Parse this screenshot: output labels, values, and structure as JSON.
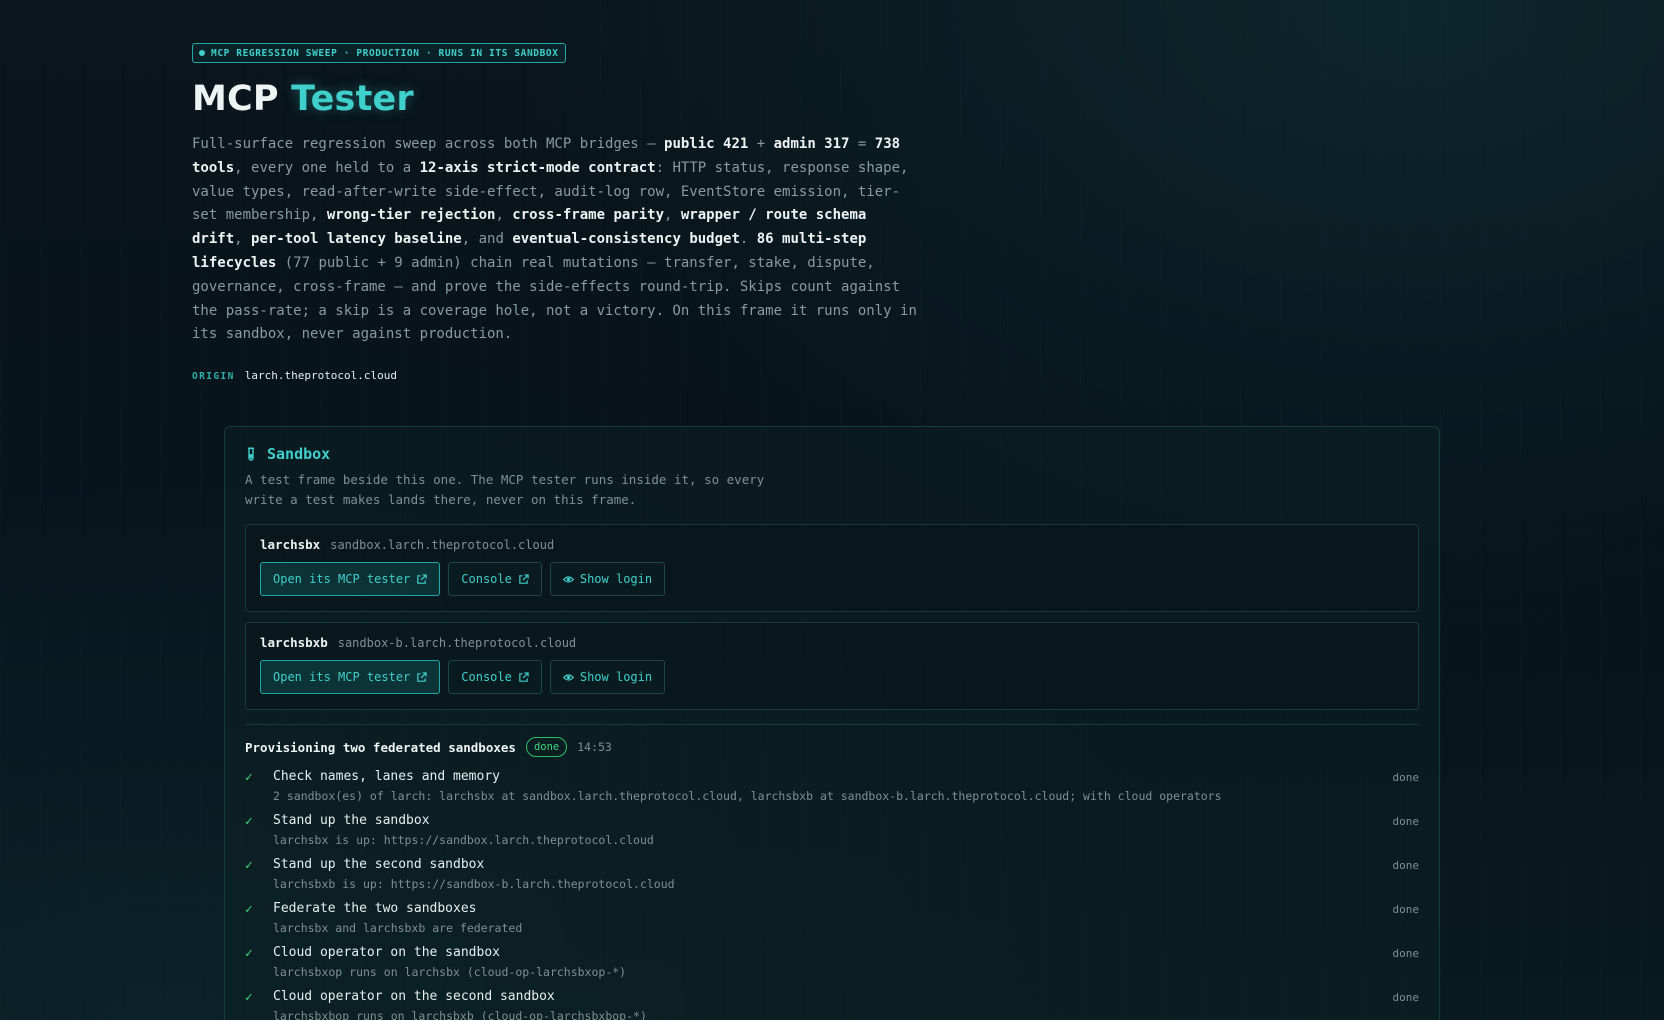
{
  "hero": {
    "pill": "MCP REGRESSION SWEEP · PRODUCTION · RUNS IN ITS SANDBOX",
    "title_a": "MCP",
    "title_b": "Tester",
    "lead": [
      {
        "t": "Full-surface regression sweep across both MCP bridges — ",
        "b": false
      },
      {
        "t": "public 421",
        "b": true
      },
      {
        "t": " + ",
        "b": false
      },
      {
        "t": "admin 317",
        "b": true
      },
      {
        "t": " = ",
        "b": false
      },
      {
        "t": "738 tools",
        "b": true
      },
      {
        "t": ", every one held to a ",
        "b": false
      },
      {
        "t": "12-axis strict-mode contract",
        "b": true
      },
      {
        "t": ": HTTP status, response shape, value types, read-after-write side-effect, audit-log row, EventStore emission, tier-set membership, ",
        "b": false
      },
      {
        "t": "wrong-tier rejection",
        "b": true
      },
      {
        "t": ", ",
        "b": false
      },
      {
        "t": "cross-frame parity",
        "b": true
      },
      {
        "t": ", ",
        "b": false
      },
      {
        "t": "wrapper / route schema drift",
        "b": true
      },
      {
        "t": ", ",
        "b": false
      },
      {
        "t": "per-tool latency baseline",
        "b": true
      },
      {
        "t": ", and ",
        "b": false
      },
      {
        "t": "eventual-consistency budget",
        "b": true
      },
      {
        "t": ". ",
        "b": false
      },
      {
        "t": "86 multi-step lifecycles",
        "b": true
      },
      {
        "t": " (77 public + 9 admin) chain real mutations — transfer, stake, dispute, governance, cross-frame — and prove the side-effects round-trip. Skips count against the pass-rate; a skip is a coverage hole, not a victory. On this frame it runs only in its sandbox, never against production.",
        "b": false
      }
    ],
    "origin_label": "ORIGIN",
    "origin_value": "larch.theprotocol.cloud"
  },
  "sandbox": {
    "title": "Sandbox",
    "description": "A test frame beside this one. The MCP tester runs inside it, so every write a test makes lands there, never on this frame.",
    "items": [
      {
        "name": "larchsbx",
        "host": "sandbox.larch.theprotocol.cloud",
        "open_label": "Open its MCP tester",
        "console_label": "Console",
        "login_label": "Show login"
      },
      {
        "name": "larchsbxb",
        "host": "sandbox-b.larch.theprotocol.cloud",
        "open_label": "Open its MCP tester",
        "console_label": "Console",
        "login_label": "Show login"
      }
    ]
  },
  "provisioning": {
    "title": "Provisioning two federated sandboxes",
    "badge": "done",
    "time": "14:53",
    "check_glyph": "✓",
    "steps": [
      {
        "name": "Check names, lanes and memory",
        "detail": "2 sandbox(es) of larch: larchsbx at sandbox.larch.theprotocol.cloud, larchsbxb at sandbox-b.larch.theprotocol.cloud; with cloud operators",
        "status": "done"
      },
      {
        "name": "Stand up the sandbox",
        "detail": "larchsbx is up: https://sandbox.larch.theprotocol.cloud",
        "status": "done"
      },
      {
        "name": "Stand up the second sandbox",
        "detail": "larchsbxb is up: https://sandbox-b.larch.theprotocol.cloud",
        "status": "done"
      },
      {
        "name": "Federate the two sandboxes",
        "detail": "larchsbx and larchsbxb are federated",
        "status": "done"
      },
      {
        "name": "Cloud operator on the sandbox",
        "detail": "larchsbxop runs on larchsbx (cloud-op-larchsbxop-*)",
        "status": "done"
      },
      {
        "name": "Cloud operator on the second sandbox",
        "detail": "larchsbxbop runs on larchsbxb (cloud-op-larchsbxbop-*)",
        "status": "done"
      }
    ]
  },
  "colors": {
    "accent": "#3fd0cc",
    "success": "#3fd77a",
    "bg": "#07121a"
  }
}
